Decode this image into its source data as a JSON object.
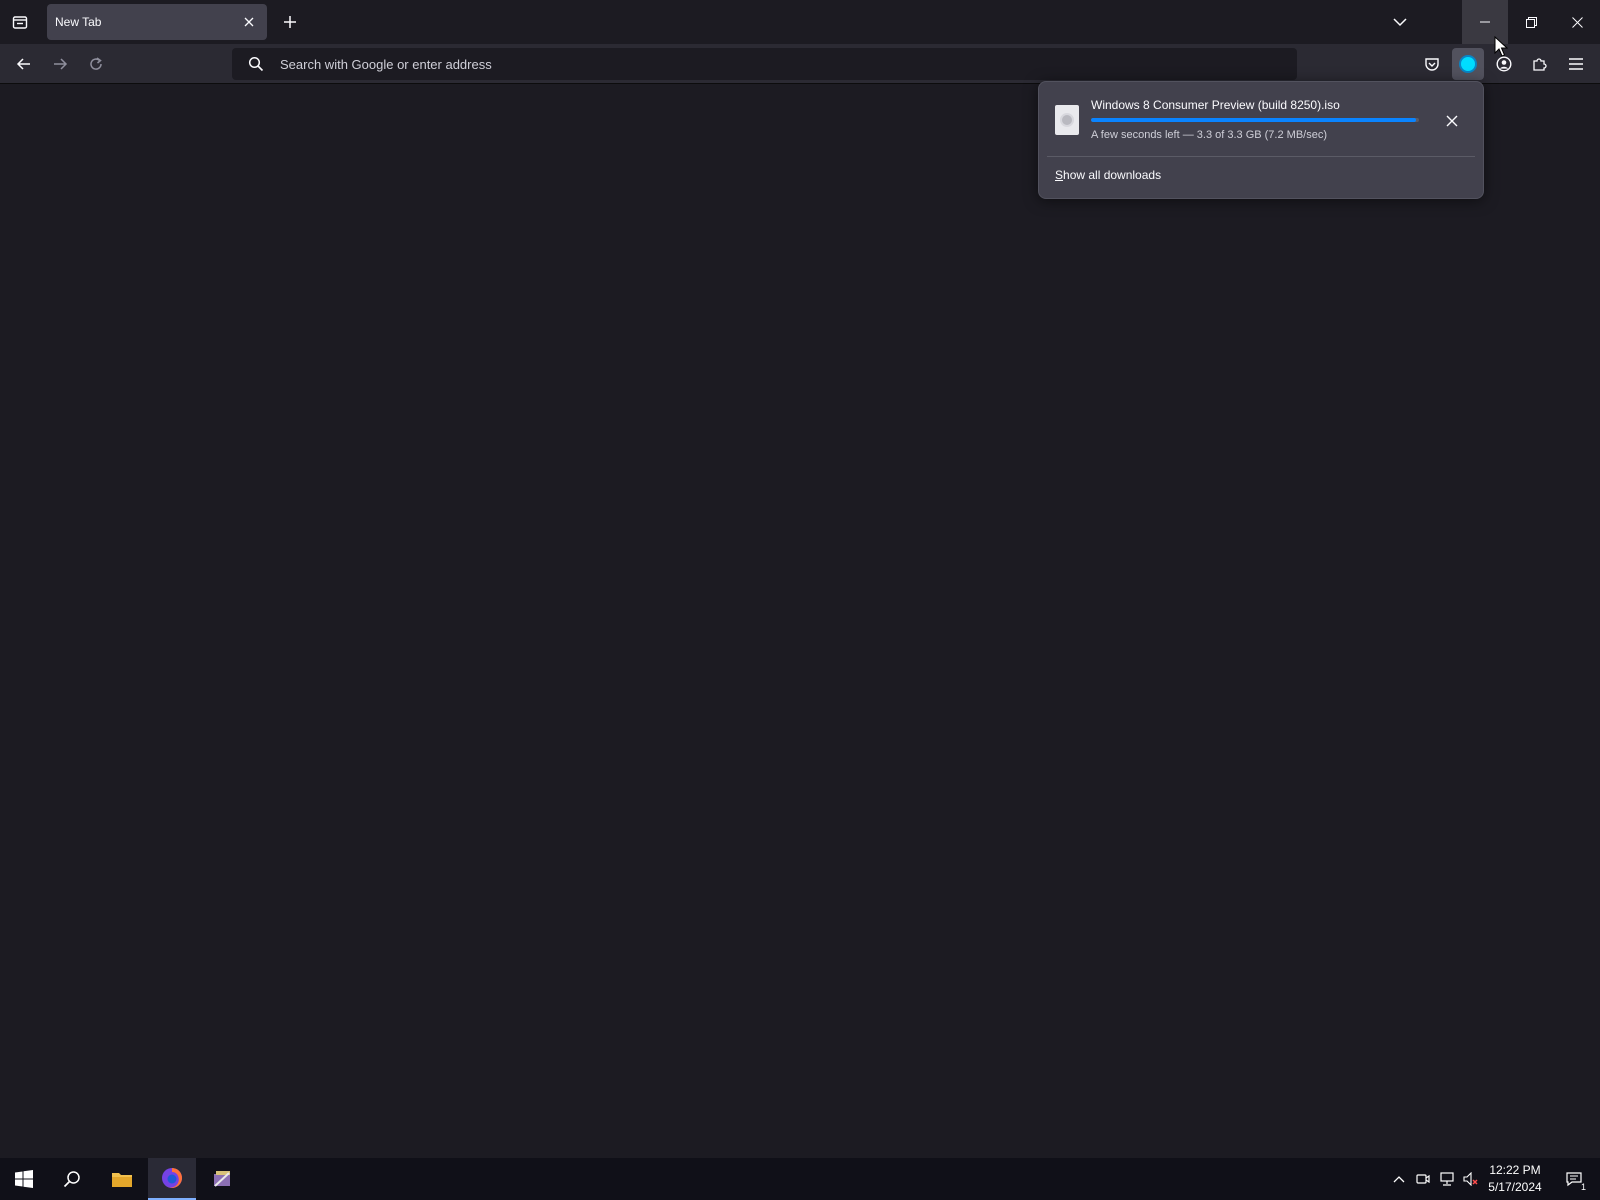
{
  "browser": {
    "tabs": [
      {
        "label": "New Tab",
        "active": true
      }
    ],
    "urlbar": {
      "placeholder": "Search with Google or enter address",
      "value": ""
    }
  },
  "downloads_panel": {
    "items": [
      {
        "filename": "Windows 8 Consumer Preview (build 8250).iso",
        "status": "A few seconds left — 3.3 of 3.3 GB (7.2 MB/sec)",
        "progress": 0.99
      }
    ],
    "show_all_label": "Show all downloads",
    "show_all_access_key": "S",
    "show_all_rest": "how all downloads"
  },
  "taskbar": {
    "clock_time": "12:22 PM",
    "clock_date": "5/17/2024",
    "notification_count": "1"
  },
  "colors": {
    "background": "#1c1b22",
    "toolbar": "#2b2a33",
    "accent": "#0a84ff",
    "download_indicator": "#00ddff"
  }
}
